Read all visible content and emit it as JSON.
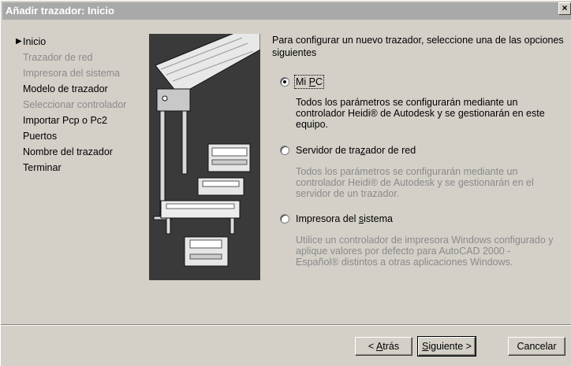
{
  "window": {
    "title": "Añadir trazador: Inicio",
    "close_label": "×"
  },
  "steps": [
    {
      "label": "Inicio",
      "state": "current"
    },
    {
      "label": "Trazador de red",
      "state": "disabled"
    },
    {
      "label": "Impresora del sistema",
      "state": "disabled"
    },
    {
      "label": "Modelo de trazador",
      "state": "enabled"
    },
    {
      "label": "Seleccionar controlador",
      "state": "disabled"
    },
    {
      "label": "Importar Pcp o Pc2",
      "state": "enabled"
    },
    {
      "label": "Puertos",
      "state": "enabled"
    },
    {
      "label": "Nombre del trazador",
      "state": "enabled"
    },
    {
      "label": "Terminar",
      "state": "enabled"
    }
  ],
  "current_marker": "▶",
  "intro": "Para configurar un nuevo trazador, seleccione una de las opciones siguientes",
  "options": [
    {
      "label_pre": "Mi ",
      "label_u": "P",
      "label_post": "C",
      "checked": true,
      "description": "Todos los parámetros se configurarán mediante un controlador Heidi® de Autodesk y se gestionarán en este equipo.",
      "enabled": true
    },
    {
      "label_pre": "Servidor de tra",
      "label_u": "z",
      "label_post": "ador de red",
      "checked": false,
      "description": "Todos los parámetros se configurarán mediante un controlador Heidi® de Autodesk y se gestionarán en el servidor de un trazador.",
      "enabled": false
    },
    {
      "label_pre": "Impresora del ",
      "label_u": "s",
      "label_post": "istema",
      "checked": false,
      "description": "Utilice un controlador de impresora Windows configurado y aplique valores por defecto para AutoCAD 2000 - Español® distintos a otras aplicaciones Windows.",
      "enabled": false
    }
  ],
  "buttons": {
    "back": {
      "pre": "< ",
      "u": "A",
      "post": "trás"
    },
    "next": {
      "pre": "",
      "u": "S",
      "post": "iguiente >"
    },
    "cancel": "Cancelar"
  }
}
